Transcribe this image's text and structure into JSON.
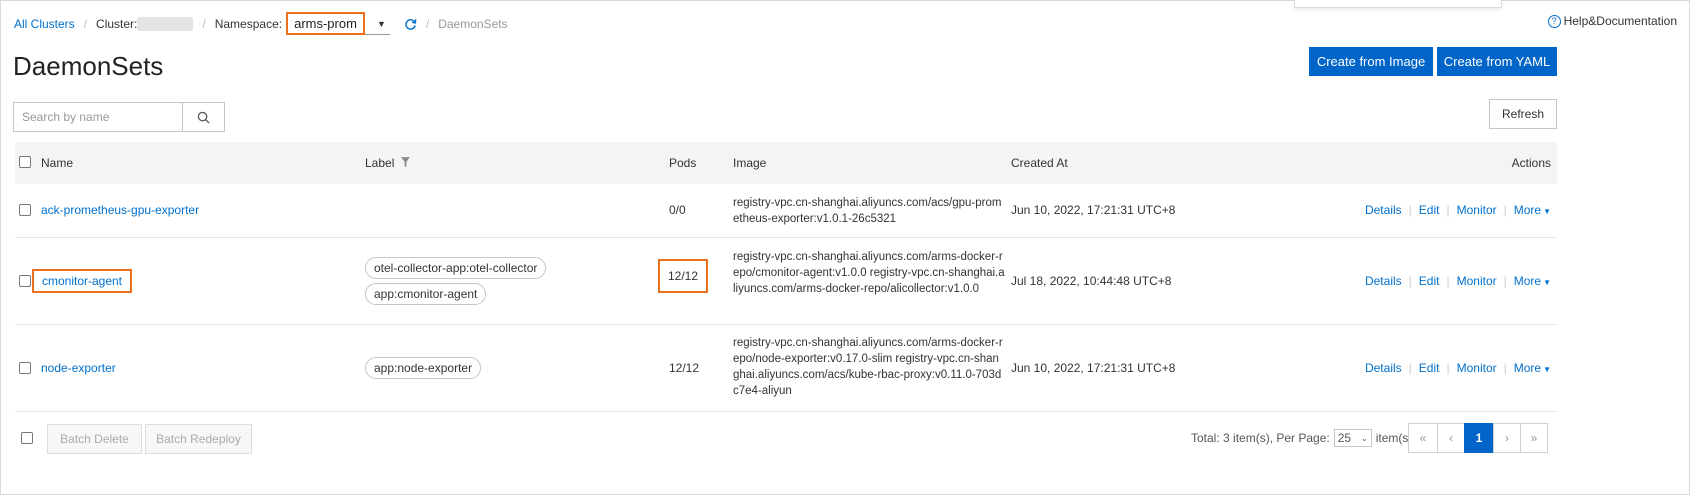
{
  "breadcrumb": {
    "all_clusters": "All Clusters",
    "cluster_label": "Cluster:",
    "namespace_label": "Namespace:",
    "namespace_value": "arms-prom",
    "current": "DaemonSets"
  },
  "help": {
    "label": "Help&Documentation"
  },
  "page": {
    "title": "DaemonSets"
  },
  "toolbar": {
    "create_from_image": "Create from Image",
    "create_from_yaml": "Create from YAML",
    "search_placeholder": "Search by name",
    "refresh": "Refresh"
  },
  "table": {
    "headers": {
      "name": "Name",
      "label": "Label",
      "pods": "Pods",
      "image": "Image",
      "created_at": "Created At",
      "actions": "Actions"
    },
    "rows": [
      {
        "name": "ack-prometheus-gpu-exporter",
        "labels": [],
        "pods": "0/0",
        "image": "registry-vpc.cn-shanghai.aliyuncs.com/acs/gpu-prometheus-exporter:v1.0.1-26c5321",
        "created_at": "Jun 10, 2022, 17:21:31 UTC+8"
      },
      {
        "name": "cmonitor-agent",
        "labels": [
          "otel-collector-app:otel-collector",
          "app:cmonitor-agent"
        ],
        "pods": "12/12",
        "image": "registry-vpc.cn-shanghai.aliyuncs.com/arms-docker-repo/cmonitor-agent:v1.0.0 registry-vpc.cn-shanghai.aliyuncs.com/arms-docker-repo/alicollector:v1.0.0",
        "created_at": "Jul 18, 2022, 10:44:48 UTC+8"
      },
      {
        "name": "node-exporter",
        "labels": [
          "app:node-exporter"
        ],
        "pods": "12/12",
        "image": "registry-vpc.cn-shanghai.aliyuncs.com/arms-docker-repo/node-exporter:v0.17.0-slim registry-vpc.cn-shanghai.aliyuncs.com/acs/kube-rbac-proxy:v0.11.0-703dc7e4-aliyun",
        "created_at": "Jun 10, 2022, 17:21:31 UTC+8"
      }
    ],
    "row_actions": {
      "details": "Details",
      "edit": "Edit",
      "monitor": "Monitor",
      "more": "More"
    }
  },
  "footer": {
    "batch_delete": "Batch Delete",
    "batch_redeploy": "Batch Redeploy",
    "total_text": "Total: 3 item(s), Per Page:",
    "per_page": "25",
    "items_suffix": "item(s)",
    "pages": {
      "first": "«",
      "prev": "‹",
      "current": "1",
      "next": "›",
      "last": "»"
    }
  },
  "colors": {
    "primary": "#0064c8",
    "link": "#0070cc",
    "highlight": "#ee6f1e"
  }
}
